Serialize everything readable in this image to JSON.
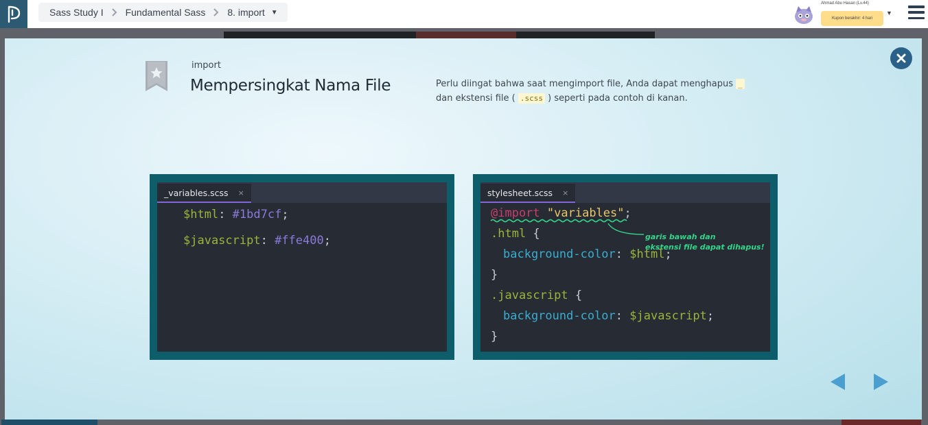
{
  "topbar": {
    "breadcrumb": [
      {
        "label": "Sass Study I"
      },
      {
        "label": "Fundamental Sass"
      },
      {
        "label": "8. import"
      }
    ],
    "user": {
      "name": "Ahmad Abu Hasan (Lv.44)",
      "coupon": "Kupon berakhir: 4 hari"
    }
  },
  "slide": {
    "subtitle": "import",
    "title": "Mempersingkat Nama File",
    "desc_part1": "Perlu diingat bahwa saat mengimport file, Anda dapat menghapus",
    "desc_code1": "_",
    "desc_part2": "dan ekstensi file (",
    "desc_code2": ".scss",
    "desc_part3": ") seperti pada contoh di kanan."
  },
  "editor_left": {
    "tab": "_variables.scss",
    "tab_close": "×",
    "lines": [
      {
        "var": "$html",
        "sep": ": ",
        "value": "#1bd7cf",
        "end": ";"
      },
      {
        "var": "$javascript",
        "sep": ": ",
        "value": "#ffe400",
        "end": ";"
      }
    ]
  },
  "editor_right": {
    "tab": "stylesheet.scss",
    "tab_close": "×",
    "at": "@import",
    "str": "\"variables\"",
    "semi": ";",
    "sel1": ".html",
    "brace_open": " {",
    "prop": "background-color",
    "colon": ": ",
    "val1": "$html",
    "brace_close": "}",
    "sel2": ".javascript",
    "val2": "$javascript",
    "annotation_line1": "garis bawah dan",
    "annotation_line2": "ekstensi file dapat dihapus!"
  },
  "colors": {
    "accent": "#2c5a73",
    "editor_border": "#0e5d6b",
    "editor_bg": "#272b34",
    "annotation": "#34d48a",
    "nav_arrow": "#4a9fd0"
  },
  "icons": [
    "logo-icon",
    "chevron-right-icon",
    "caret-down-icon",
    "avatar-icon",
    "menu-icon",
    "close-icon",
    "bookmark-star-icon",
    "arrow-left-icon",
    "arrow-right-icon"
  ]
}
